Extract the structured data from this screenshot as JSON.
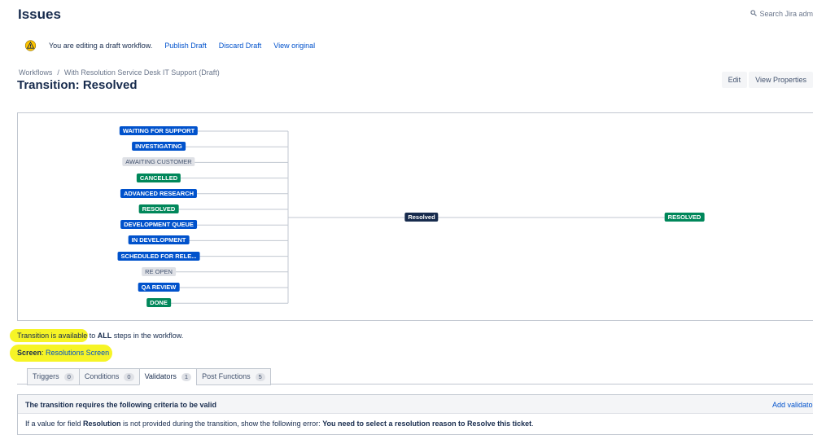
{
  "header": {
    "title": "Issues",
    "search_label": "Search Jira adm"
  },
  "draft_bar": {
    "message": "You are editing a draft workflow.",
    "publish": "Publish Draft",
    "discard": "Discard Draft",
    "view_original": "View original"
  },
  "breadcrumb": {
    "root": "Workflows",
    "separator": "/",
    "workflow": "With Resolution Service Desk IT Support (Draft)"
  },
  "transition": {
    "title": "Transition: Resolved",
    "name": "Resolved"
  },
  "actions": {
    "edit": "Edit",
    "view_properties": "View Properties"
  },
  "diagram": {
    "from_statuses": [
      {
        "label": "WAITING FOR SUPPORT",
        "category": "blue"
      },
      {
        "label": "INVESTIGATING",
        "category": "blue"
      },
      {
        "label": "AWAITING CUSTOMER",
        "category": "grey"
      },
      {
        "label": "CANCELLED",
        "category": "green"
      },
      {
        "label": "ADVANCED RESEARCH",
        "category": "blue"
      },
      {
        "label": "RESOLVED",
        "category": "green"
      },
      {
        "label": "DEVELOPMENT QUEUE",
        "category": "blue"
      },
      {
        "label": "IN DEVELOPMENT",
        "category": "blue"
      },
      {
        "label": "SCHEDULED FOR RELE...",
        "category": "blue"
      },
      {
        "label": "RE OPEN",
        "category": "grey"
      },
      {
        "label": "QA REVIEW",
        "category": "blue"
      },
      {
        "label": "DONE",
        "category": "green"
      }
    ],
    "to_status": {
      "label": "RESOLVED",
      "category": "green"
    },
    "colors": {
      "blue": "#0052cc",
      "green": "#00875a",
      "grey": "#dfe1e6",
      "line": "#c1c7d0"
    }
  },
  "availability": {
    "prefix": "Transition is available to ",
    "bold": "ALL",
    "suffix": " steps in the workflow."
  },
  "screen": {
    "label": "Screen",
    "colon": ": ",
    "value": "Resolutions Screen"
  },
  "highlight_color": "#f4f200",
  "tabs": [
    {
      "label": "Triggers",
      "count": "0"
    },
    {
      "label": "Conditions",
      "count": "0"
    },
    {
      "label": "Validators",
      "count": "1",
      "active": true
    },
    {
      "label": "Post Functions",
      "count": "5"
    }
  ],
  "criteria": {
    "title": "The transition requires the following criteria to be valid",
    "add_label": "Add validator",
    "body_prefix": "If a value for field ",
    "field": "Resolution",
    "body_middle": " is not provided during the transition, show the following error: ",
    "error": "You need to select a resolution reason to Resolve this ticket",
    "body_end": "."
  },
  "icons": {
    "warning": "warning-icon",
    "search": "search-icon"
  }
}
